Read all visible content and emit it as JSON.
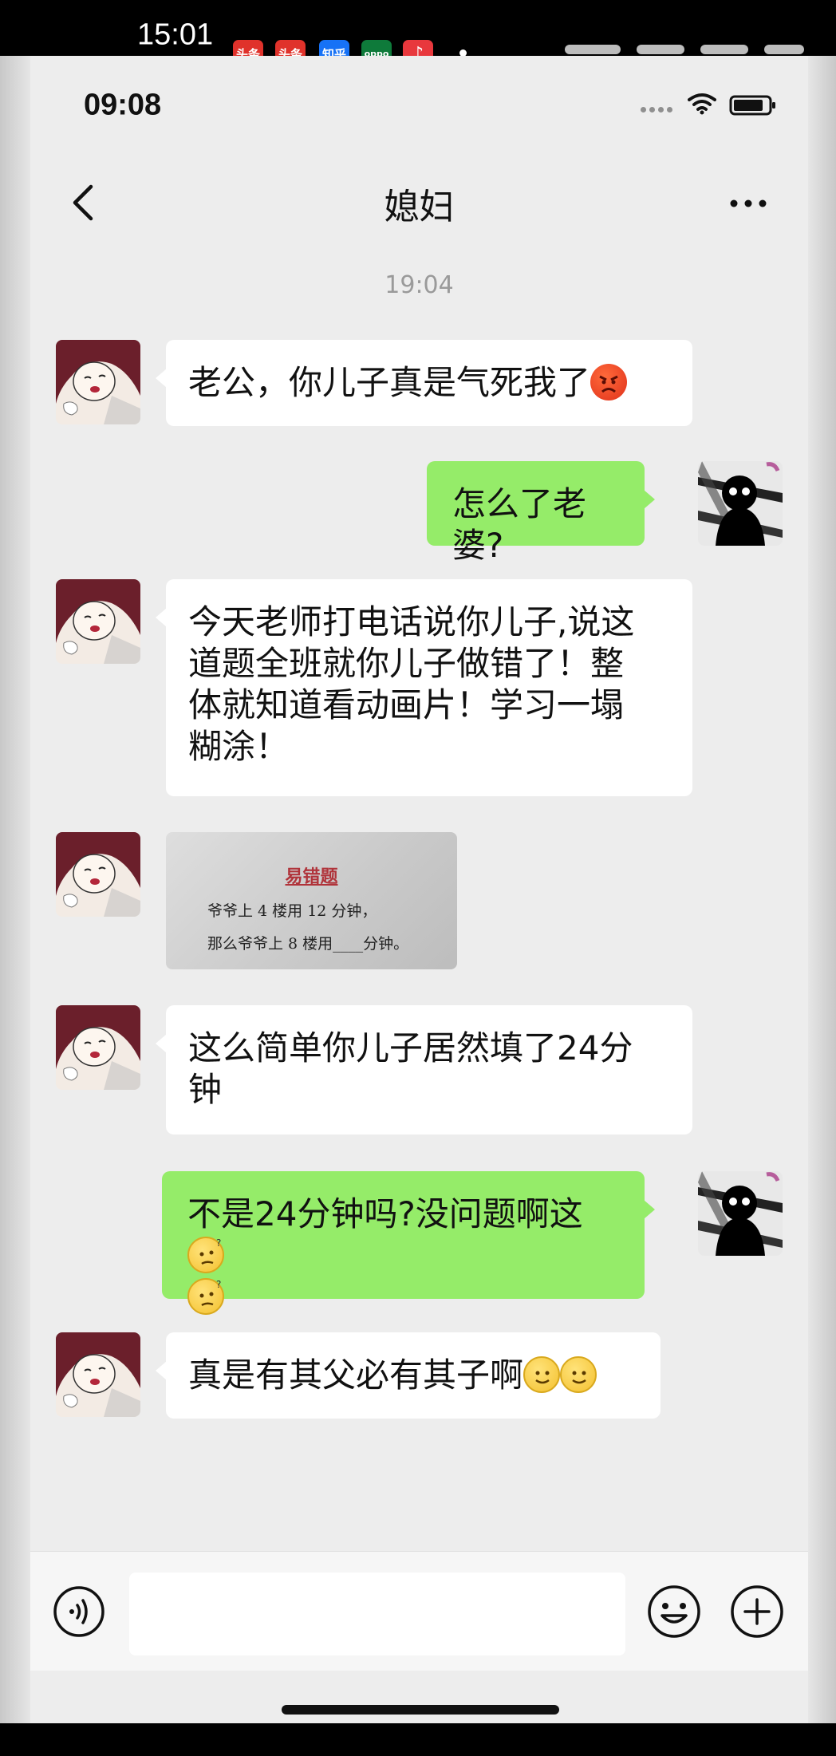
{
  "device_status": {
    "time": "15:01",
    "app_badges": [
      {
        "label": "头条",
        "color": "#e0322b",
        "icon": "toutiao-icon"
      },
      {
        "label": "头条",
        "color": "#e0322b",
        "icon": "toutiao-icon"
      },
      {
        "label": "知乎",
        "color": "#1772f6",
        "icon": "zhihu-icon"
      },
      {
        "label": "oppo",
        "color": "#0e7a3a",
        "icon": "oppo-icon"
      },
      {
        "label": "♪",
        "color": "#e8383d",
        "icon": "music-icon"
      }
    ]
  },
  "status": {
    "time": "09:08"
  },
  "header": {
    "title": "媳妇"
  },
  "chat": {
    "timestamp": "19:04",
    "messages": [
      {
        "side": "in",
        "text": "老公，你儿子真是气死我了",
        "emoji": "angry-face"
      },
      {
        "side": "out",
        "text": "怎么了老婆?"
      },
      {
        "side": "in",
        "text": "今天老师打电话说你儿子,说这道题全班就你儿子做错了！整体就知道看动画片！学习一塌糊涂！",
        "lines": [
          "今天老师打电话说你儿子,说这",
          "道题全班就你儿子做错了！整",
          "体就知道看动画片！学习一塌",
          "糊涂！"
        ]
      },
      {
        "side": "in",
        "type": "image",
        "image": {
          "title": "易错题",
          "line1": "爷爷上 4 楼用 12 分钟，",
          "line2": "那么爷爷上 8 楼用____分钟。"
        }
      },
      {
        "side": "in",
        "text": "这么简单你儿子居然填了24分钟",
        "lines": [
          "这么简单你儿子居然填了24分",
          "钟"
        ]
      },
      {
        "side": "out",
        "text": "不是24分钟吗?没问题啊这",
        "emoji": "thinking-face"
      },
      {
        "side": "in",
        "text": "真是有其父必有其子啊",
        "emoji": "smile-face"
      }
    ]
  },
  "input_bar": {
    "placeholder": ""
  },
  "colors": {
    "background": "#ededed",
    "outgoing_bubble": "#95ec69",
    "incoming_bubble": "#ffffff"
  }
}
